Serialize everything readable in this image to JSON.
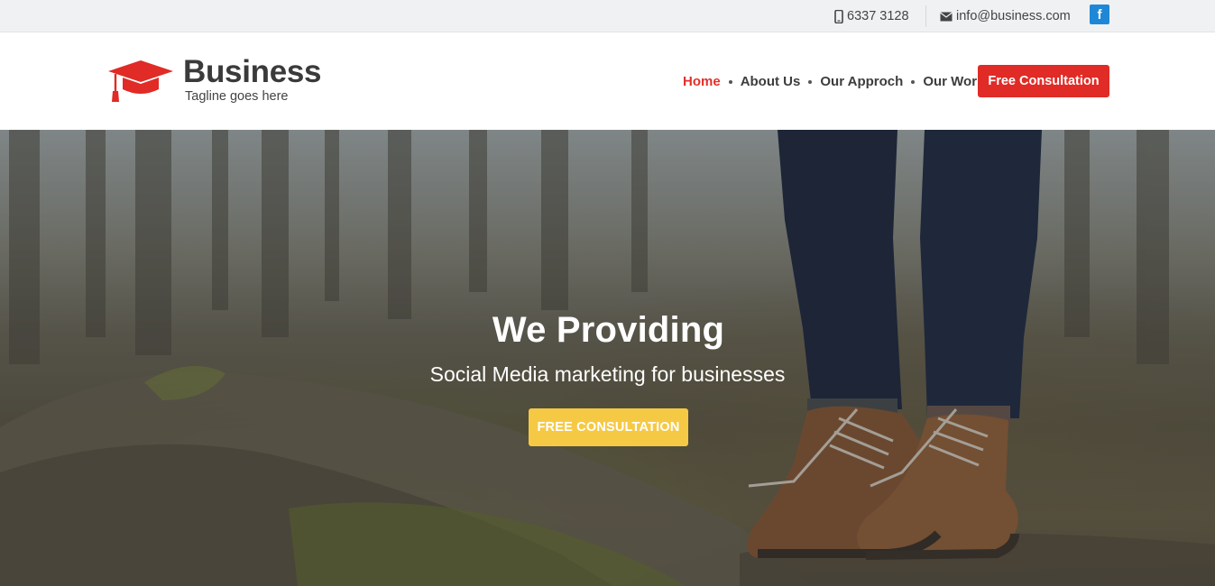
{
  "topbar": {
    "phone": "6337 3128",
    "email": "info@business.com",
    "social": {
      "icon": "facebook-icon",
      "glyph": "f",
      "color": "#1e88d6"
    }
  },
  "header": {
    "brand": "Business",
    "tagline": "Tagline goes here",
    "logo_icon": "graduation-cap-icon",
    "logo_color": "#e02b26"
  },
  "nav": {
    "items": [
      {
        "label": "Home",
        "active": true
      },
      {
        "label": "About Us",
        "active": false
      },
      {
        "label": "Our Approch",
        "active": false
      },
      {
        "label": "Our Work",
        "active": false
      }
    ],
    "cta_label": "Free Consultation",
    "active_color": "#e3302a",
    "cta_color": "#e02b26"
  },
  "hero": {
    "title": "We Providing",
    "subtitle": "Social Media marketing for businesses",
    "button_label": "FREE CONSULTATION",
    "button_color": "#f6c945"
  }
}
